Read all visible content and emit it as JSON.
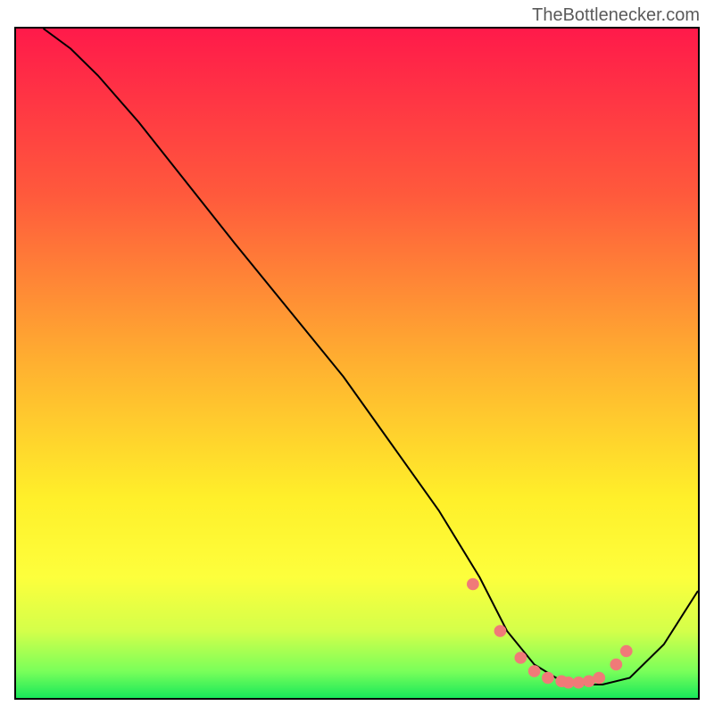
{
  "watermark": "TheBottlenecker.com",
  "chart_data": {
    "type": "line",
    "title": "",
    "xlabel": "",
    "ylabel": "",
    "xlim": [
      0,
      100
    ],
    "ylim": [
      0,
      100
    ],
    "grid": false,
    "gradient_stops": [
      {
        "offset": 0,
        "color": "#ff1a4a"
      },
      {
        "offset": 0.25,
        "color": "#ff5a3c"
      },
      {
        "offset": 0.5,
        "color": "#ffb030"
      },
      {
        "offset": 0.7,
        "color": "#ffef2a"
      },
      {
        "offset": 0.82,
        "color": "#fdff3c"
      },
      {
        "offset": 0.9,
        "color": "#d4ff4a"
      },
      {
        "offset": 0.96,
        "color": "#7aff5a"
      },
      {
        "offset": 1.0,
        "color": "#18e85a"
      }
    ],
    "series": [
      {
        "name": "bottleneck-curve",
        "x": [
          4,
          8,
          12,
          18,
          25,
          32,
          40,
          48,
          55,
          62,
          68,
          72,
          76,
          80,
          83,
          86,
          90,
          95,
          100
        ],
        "y": [
          100,
          97,
          93,
          86,
          77,
          68,
          58,
          48,
          38,
          28,
          18,
          10,
          5,
          2.5,
          2,
          2,
          3,
          8,
          16
        ]
      }
    ],
    "markers": {
      "name": "highlight-dots",
      "color": "#f07a78",
      "x": [
        67,
        71,
        74,
        76,
        78,
        80,
        81,
        82.5,
        84,
        85.5,
        88,
        89.5
      ],
      "y": [
        17,
        10,
        6,
        4,
        3,
        2.5,
        2.3,
        2.3,
        2.5,
        3,
        5,
        7
      ]
    }
  }
}
